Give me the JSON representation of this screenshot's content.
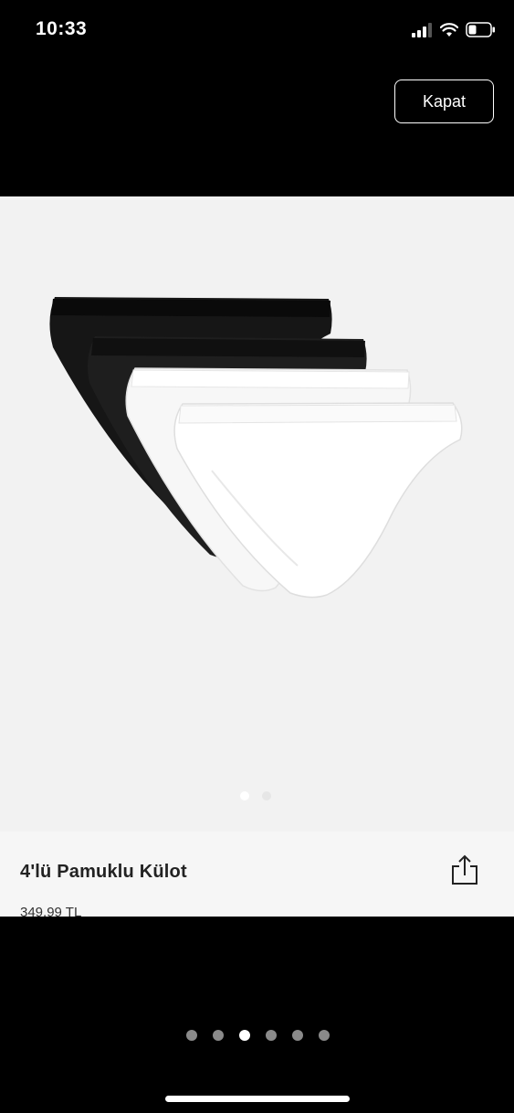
{
  "status_bar": {
    "time": "10:33"
  },
  "header": {
    "close_label": "Kapat"
  },
  "product": {
    "name": "4'lü Pamuklu Külot",
    "price": "349,99 TL",
    "image_pages": 2,
    "image_active_index": 0
  },
  "gallery": {
    "pages": 6,
    "active_index": 2
  },
  "colors": {
    "overlay": "#000000",
    "sheet_bg": "#f2f2f2",
    "text": "#222222"
  },
  "icons": {
    "share": "share-icon",
    "signal": "signal-icon",
    "wifi": "wifi-icon",
    "battery": "battery-icon"
  }
}
